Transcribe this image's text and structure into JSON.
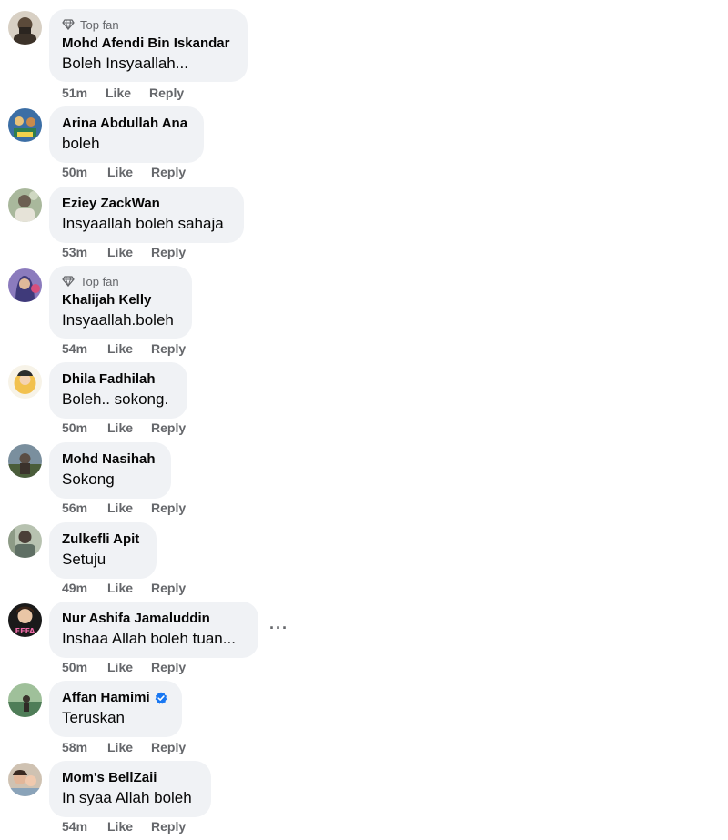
{
  "comments": [
    {
      "badge": "Top fan",
      "author": "Mohd Afendi Bin Iskandar",
      "text": "Boleh Insyaallah...",
      "time": "51m",
      "like": "Like",
      "reply": "Reply",
      "avatar_color": "#5b4a3a"
    },
    {
      "author": "Arina Abdullah Ana",
      "text": "boleh",
      "time": "50m",
      "like": "Like",
      "reply": "Reply",
      "avatar_color": "#2f6aa8"
    },
    {
      "author": "Eziey ZackWan",
      "text": "Insyaallah boleh sahaja",
      "time": "53m",
      "like": "Like",
      "reply": "Reply",
      "avatar_color": "#8fa68a"
    },
    {
      "badge": "Top fan",
      "author": "Khalijah Kelly",
      "text": "Insyaallah.boleh",
      "time": "54m",
      "like": "Like",
      "reply": "Reply",
      "avatar_color": "#6f5aa8"
    },
    {
      "author": "Dhila Fadhilah",
      "text": "Boleh.. sokong.",
      "time": "50m",
      "like": "Like",
      "reply": "Reply",
      "avatar_color": "#f2c14e"
    },
    {
      "author": "Mohd Nasihah",
      "text": "Sokong",
      "time": "56m",
      "like": "Like",
      "reply": "Reply",
      "avatar_color": "#5a4d44"
    },
    {
      "author": "Zulkefli Apit",
      "text": "Setuju",
      "time": "49m",
      "like": "Like",
      "reply": "Reply",
      "avatar_color": "#6f7d72"
    },
    {
      "author": "Nur Ashifa Jamaluddin",
      "text": "Inshaa Allah boleh tuan...",
      "time": "50m",
      "like": "Like",
      "reply": "Reply",
      "more": "···",
      "avatar_color": "#1a1a1a",
      "avatar_text": "EFFA"
    },
    {
      "author": "Affan Hamimi",
      "verified": true,
      "text": "Teruskan",
      "time": "58m",
      "like": "Like",
      "reply": "Reply",
      "avatar_color": "#4f7d58"
    },
    {
      "author": "Mom's BellZaii",
      "text": "In syaa Allah boleh",
      "time": "54m",
      "like": "Like",
      "reply": "Reply",
      "avatar_color": "#b9a58f"
    }
  ],
  "icons": {
    "badge": "diamond-icon",
    "verified": "verified-badge-icon",
    "more": "more-options-icon"
  },
  "colors": {
    "bubble": "#f0f2f5",
    "meta": "#65676b",
    "verified": "#1877f2"
  }
}
